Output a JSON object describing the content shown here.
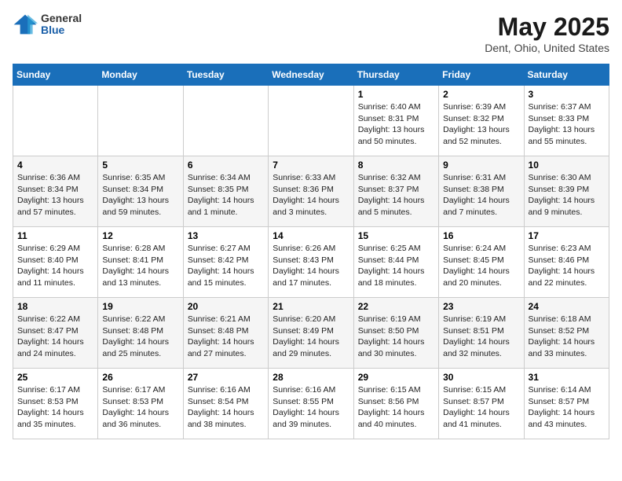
{
  "logo": {
    "general": "General",
    "blue": "Blue"
  },
  "title": "May 2025",
  "subtitle": "Dent, Ohio, United States",
  "days_header": [
    "Sunday",
    "Monday",
    "Tuesday",
    "Wednesday",
    "Thursday",
    "Friday",
    "Saturday"
  ],
  "weeks": [
    [
      {
        "num": "",
        "info": ""
      },
      {
        "num": "",
        "info": ""
      },
      {
        "num": "",
        "info": ""
      },
      {
        "num": "",
        "info": ""
      },
      {
        "num": "1",
        "info": "Sunrise: 6:40 AM\nSunset: 8:31 PM\nDaylight: 13 hours\nand 50 minutes."
      },
      {
        "num": "2",
        "info": "Sunrise: 6:39 AM\nSunset: 8:32 PM\nDaylight: 13 hours\nand 52 minutes."
      },
      {
        "num": "3",
        "info": "Sunrise: 6:37 AM\nSunset: 8:33 PM\nDaylight: 13 hours\nand 55 minutes."
      }
    ],
    [
      {
        "num": "4",
        "info": "Sunrise: 6:36 AM\nSunset: 8:34 PM\nDaylight: 13 hours\nand 57 minutes."
      },
      {
        "num": "5",
        "info": "Sunrise: 6:35 AM\nSunset: 8:34 PM\nDaylight: 13 hours\nand 59 minutes."
      },
      {
        "num": "6",
        "info": "Sunrise: 6:34 AM\nSunset: 8:35 PM\nDaylight: 14 hours\nand 1 minute."
      },
      {
        "num": "7",
        "info": "Sunrise: 6:33 AM\nSunset: 8:36 PM\nDaylight: 14 hours\nand 3 minutes."
      },
      {
        "num": "8",
        "info": "Sunrise: 6:32 AM\nSunset: 8:37 PM\nDaylight: 14 hours\nand 5 minutes."
      },
      {
        "num": "9",
        "info": "Sunrise: 6:31 AM\nSunset: 8:38 PM\nDaylight: 14 hours\nand 7 minutes."
      },
      {
        "num": "10",
        "info": "Sunrise: 6:30 AM\nSunset: 8:39 PM\nDaylight: 14 hours\nand 9 minutes."
      }
    ],
    [
      {
        "num": "11",
        "info": "Sunrise: 6:29 AM\nSunset: 8:40 PM\nDaylight: 14 hours\nand 11 minutes."
      },
      {
        "num": "12",
        "info": "Sunrise: 6:28 AM\nSunset: 8:41 PM\nDaylight: 14 hours\nand 13 minutes."
      },
      {
        "num": "13",
        "info": "Sunrise: 6:27 AM\nSunset: 8:42 PM\nDaylight: 14 hours\nand 15 minutes."
      },
      {
        "num": "14",
        "info": "Sunrise: 6:26 AM\nSunset: 8:43 PM\nDaylight: 14 hours\nand 17 minutes."
      },
      {
        "num": "15",
        "info": "Sunrise: 6:25 AM\nSunset: 8:44 PM\nDaylight: 14 hours\nand 18 minutes."
      },
      {
        "num": "16",
        "info": "Sunrise: 6:24 AM\nSunset: 8:45 PM\nDaylight: 14 hours\nand 20 minutes."
      },
      {
        "num": "17",
        "info": "Sunrise: 6:23 AM\nSunset: 8:46 PM\nDaylight: 14 hours\nand 22 minutes."
      }
    ],
    [
      {
        "num": "18",
        "info": "Sunrise: 6:22 AM\nSunset: 8:47 PM\nDaylight: 14 hours\nand 24 minutes."
      },
      {
        "num": "19",
        "info": "Sunrise: 6:22 AM\nSunset: 8:48 PM\nDaylight: 14 hours\nand 25 minutes."
      },
      {
        "num": "20",
        "info": "Sunrise: 6:21 AM\nSunset: 8:48 PM\nDaylight: 14 hours\nand 27 minutes."
      },
      {
        "num": "21",
        "info": "Sunrise: 6:20 AM\nSunset: 8:49 PM\nDaylight: 14 hours\nand 29 minutes."
      },
      {
        "num": "22",
        "info": "Sunrise: 6:19 AM\nSunset: 8:50 PM\nDaylight: 14 hours\nand 30 minutes."
      },
      {
        "num": "23",
        "info": "Sunrise: 6:19 AM\nSunset: 8:51 PM\nDaylight: 14 hours\nand 32 minutes."
      },
      {
        "num": "24",
        "info": "Sunrise: 6:18 AM\nSunset: 8:52 PM\nDaylight: 14 hours\nand 33 minutes."
      }
    ],
    [
      {
        "num": "25",
        "info": "Sunrise: 6:17 AM\nSunset: 8:53 PM\nDaylight: 14 hours\nand 35 minutes."
      },
      {
        "num": "26",
        "info": "Sunrise: 6:17 AM\nSunset: 8:53 PM\nDaylight: 14 hours\nand 36 minutes."
      },
      {
        "num": "27",
        "info": "Sunrise: 6:16 AM\nSunset: 8:54 PM\nDaylight: 14 hours\nand 38 minutes."
      },
      {
        "num": "28",
        "info": "Sunrise: 6:16 AM\nSunset: 8:55 PM\nDaylight: 14 hours\nand 39 minutes."
      },
      {
        "num": "29",
        "info": "Sunrise: 6:15 AM\nSunset: 8:56 PM\nDaylight: 14 hours\nand 40 minutes."
      },
      {
        "num": "30",
        "info": "Sunrise: 6:15 AM\nSunset: 8:57 PM\nDaylight: 14 hours\nand 41 minutes."
      },
      {
        "num": "31",
        "info": "Sunrise: 6:14 AM\nSunset: 8:57 PM\nDaylight: 14 hours\nand 43 minutes."
      }
    ]
  ]
}
